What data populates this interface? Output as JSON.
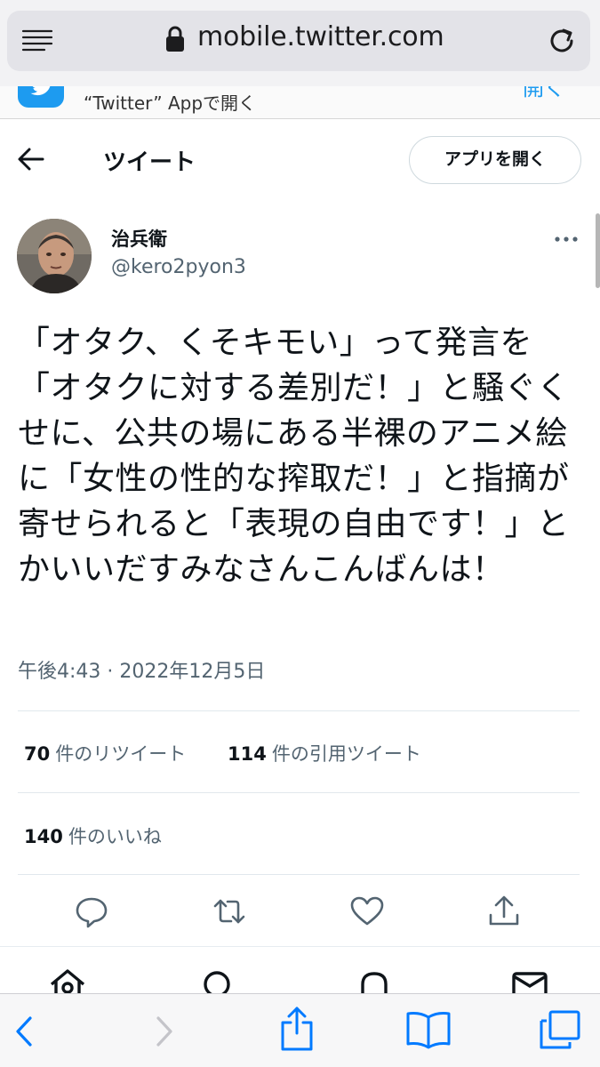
{
  "browser": {
    "url": "mobile.twitter.com"
  },
  "banner": {
    "text": "“Twitter” Appで開く",
    "open_label": "開く"
  },
  "header": {
    "title": "ツイート",
    "open_app_label": "アプリを開く"
  },
  "tweet": {
    "display_name": "治兵衛",
    "handle": "@kero2pyon3",
    "text": "「オタク、くそキモい」って発言を「オタクに対する差別だ！」と騒ぐくせに、公共の場にある半裸のアニメ絵に「女性の性的な搾取だ！」と指摘が寄せられると「表現の自由です！」とかいいだすみなさんこんばんは！",
    "timestamp": "午後4:43 · 2022年12月5日"
  },
  "stats": {
    "retweets_count": "70",
    "retweets_label": "件のリツイート",
    "quotes_count": "114",
    "quotes_label": "件の引用ツイート",
    "likes_count": "140",
    "likes_label": "件のいいね"
  },
  "colors": {
    "accent": "#1d9bf0",
    "text": "#0f1419",
    "secondary": "#536471",
    "safari_blue": "#007aff"
  },
  "icons": {
    "actions": [
      "reply-icon",
      "retweet-icon",
      "like-icon",
      "share-icon"
    ],
    "nav": [
      "home-icon",
      "search-icon",
      "notifications-icon",
      "messages-icon"
    ],
    "safari": [
      "back-icon",
      "forward-icon",
      "share-icon",
      "bookmarks-icon",
      "tabs-icon"
    ]
  }
}
